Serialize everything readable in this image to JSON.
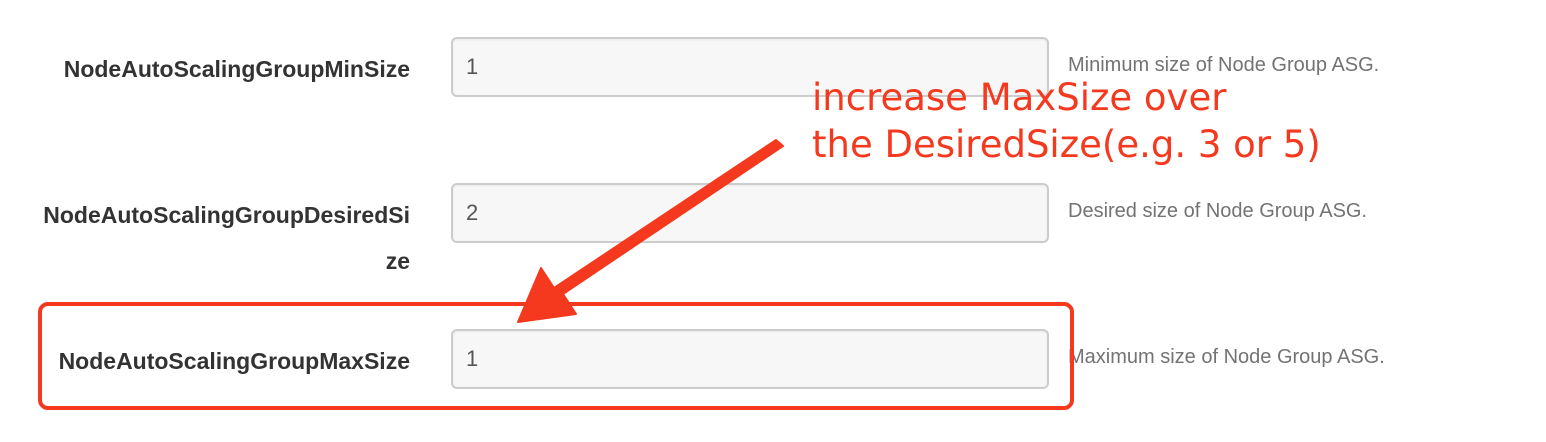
{
  "params": [
    {
      "name": "NodeAutoScalingGroupMinSize",
      "value": "1",
      "description": "Minimum size of Node Group ASG."
    },
    {
      "name": "NodeAutoScalingGroupDesiredSize",
      "value": "2",
      "description": "Desired size of Node Group ASG."
    },
    {
      "name": "NodeAutoScalingGroupMaxSize",
      "value": "1",
      "description": "Maximum size of Node Group ASG."
    }
  ],
  "annotation": {
    "line1": "increase MaxSize over",
    "line2": "the DesiredSize(e.g. 3 or 5)",
    "color": "#f4391f"
  }
}
